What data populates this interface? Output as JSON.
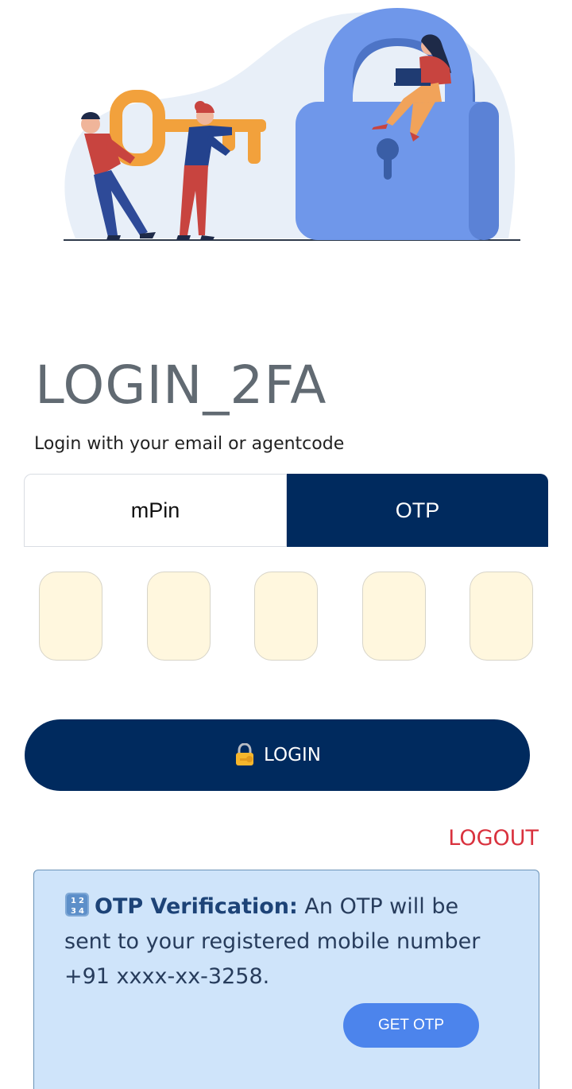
{
  "app": {
    "title": "LOGIN_2FA",
    "subtitle": "Login with your email or agentcode"
  },
  "tabs": [
    {
      "label": "mPin",
      "active": false
    },
    {
      "label": "OTP",
      "active": true
    }
  ],
  "otp_boxes": [
    "",
    "",
    "",
    "",
    ""
  ],
  "login_button": {
    "label": "LOGIN",
    "icon": "lock-with-key-icon"
  },
  "logout_link": {
    "label": "LOGOUT"
  },
  "otp_info": {
    "icon": "input-numbers-icon",
    "lead": "OTP Verification:",
    "message": " An OTP will be sent to your registered mobile number +91 xxxx-xx-3258.",
    "button_label": "GET OTP"
  },
  "colors": {
    "primary_navy": "#002a5e",
    "otp_box_fill": "#fff7de",
    "logout_red": "#d9323e",
    "info_bg": "#cfe4fa",
    "get_otp_blue": "#4c84ec"
  }
}
